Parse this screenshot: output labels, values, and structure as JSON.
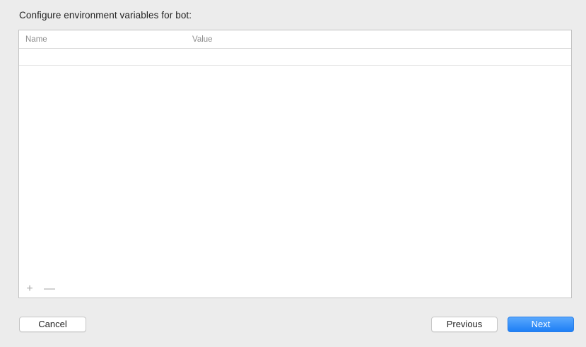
{
  "heading": "Configure environment variables for bot:",
  "table": {
    "columns": [
      "Name",
      "Value"
    ],
    "rows": []
  },
  "controls": {
    "add_symbol": "+",
    "remove_symbol": "—"
  },
  "buttons": {
    "cancel": "Cancel",
    "previous": "Previous",
    "next": "Next"
  },
  "colors": {
    "accent": "#1d7ff5",
    "background": "#ececec"
  }
}
